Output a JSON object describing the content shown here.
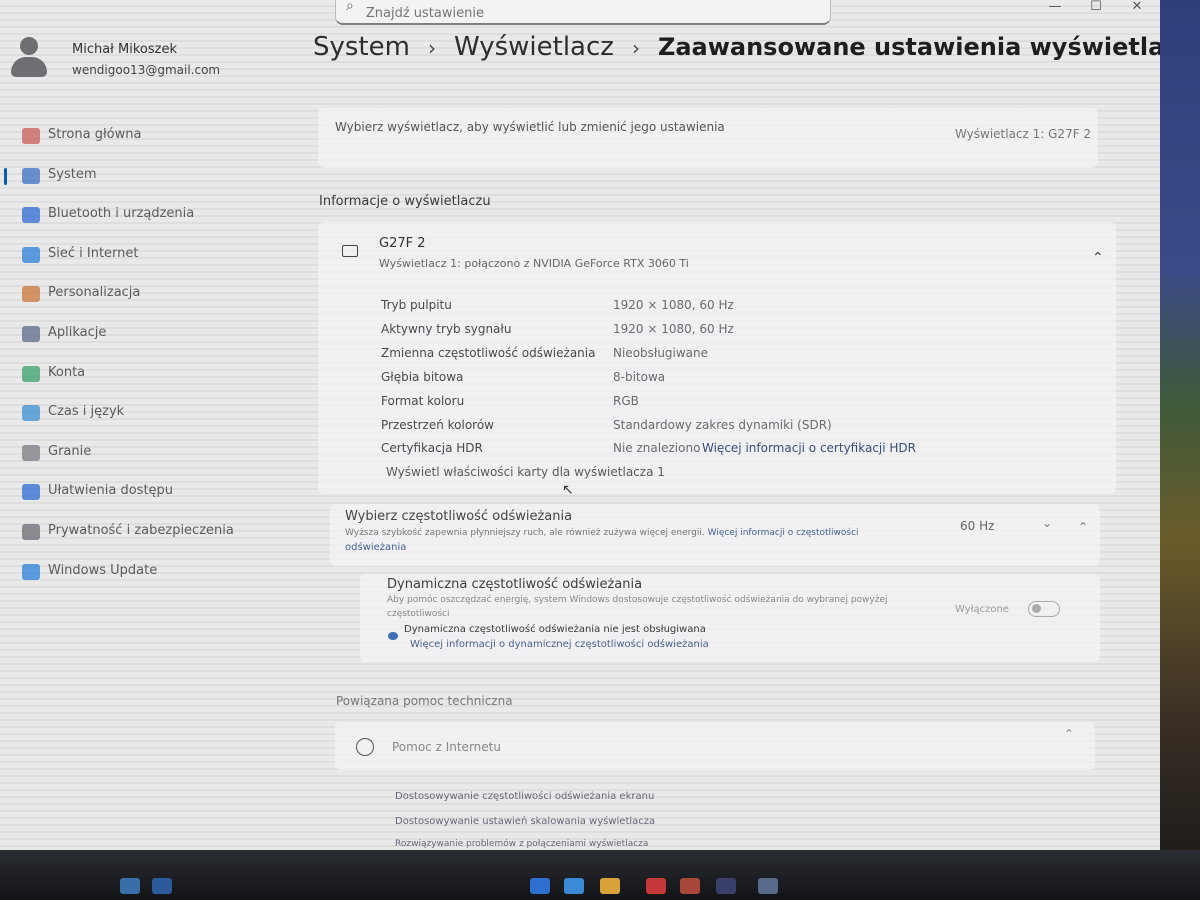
{
  "window": {
    "minimize_glyph": "—",
    "maximize_glyph": "☐",
    "close_glyph": "✕"
  },
  "search": {
    "placeholder": "Znajdź ustawienie"
  },
  "user": {
    "name": "Michał Mikoszek",
    "email": "wendigoo13@gmail.com"
  },
  "breadcrumb": {
    "items": [
      "System",
      "Wyświetlacz",
      "Zaawansowane ustawienia wyświetlacza"
    ],
    "separator": "›"
  },
  "sidebar": {
    "items": [
      {
        "label": "Strona główna",
        "icon": "home-icon",
        "color": "#c75a5a"
      },
      {
        "label": "System",
        "icon": "system-icon",
        "color": "#3b6fc4",
        "active": true
      },
      {
        "label": "Bluetooth i urządzenia",
        "icon": "bluetooth-icon",
        "color": "#2f6bd1"
      },
      {
        "label": "Sieć i Internet",
        "icon": "wifi-icon",
        "color": "#2b7fd6"
      },
      {
        "label": "Personalizacja",
        "icon": "brush-icon",
        "color": "#c9773a"
      },
      {
        "label": "Aplikacje",
        "icon": "apps-icon",
        "color": "#5b6a8a"
      },
      {
        "label": "Konta",
        "icon": "account-icon",
        "color": "#3aa06b"
      },
      {
        "label": "Czas i język",
        "icon": "globe-clock-icon",
        "color": "#3b8fd0"
      },
      {
        "label": "Granie",
        "icon": "gamepad-icon",
        "color": "#7a7a80"
      },
      {
        "label": "Ułatwienia dostępu",
        "icon": "accessibility-icon",
        "color": "#2f6bd1"
      },
      {
        "label": "Prywatność i zabezpieczenia",
        "icon": "shield-icon",
        "color": "#6a6a70"
      },
      {
        "label": "Windows Update",
        "icon": "update-icon",
        "color": "#2b7fd6"
      }
    ]
  },
  "main": {
    "select_display_label": "Wybierz wyświetlacz, aby wyświetlić lub zmienić jego ustawienia",
    "select_display_value": "Wyświetlacz 1: G27F 2",
    "display_info_heading": "Informacje o wyświetlaczu",
    "display": {
      "name": "G27F 2",
      "subtitle": "Wyświetlacz 1: połączono z NVIDIA GeForce RTX 3060 Ti",
      "collapse_glyph": "⌃",
      "rows": [
        {
          "label": "Tryb pulpitu",
          "value": "1920 × 1080, 60 Hz"
        },
        {
          "label": "Aktywny tryb sygnału",
          "value": "1920 × 1080, 60 Hz"
        },
        {
          "label": "Zmienna częstotliwość odświeżania",
          "value": "Nieobsługiwane"
        },
        {
          "label": "Głębia bitowa",
          "value": "8-bitowa"
        },
        {
          "label": "Format koloru",
          "value": "RGB"
        },
        {
          "label": "Przestrzeń kolorów",
          "value": "Standardowy zakres dynamiki (SDR)"
        },
        {
          "label": "Certyfikacja HDR",
          "value": "Nie znaleziono",
          "link": "Więcej informacji o certyfikacji HDR"
        }
      ],
      "adapter_link": "Wyświetl właściwości karty dla wyświetlacza 1"
    },
    "refresh": {
      "title": "Wybierz częstotliwość odświeżania",
      "desc_line1": "Wyższa szybkość zapewnia płynniejszy ruch, ale również zużywa więcej energii.",
      "desc_link": "Więcej informacji o częstotliwości",
      "desc_line2": "odświeżania",
      "value": "60 Hz",
      "dropdown_glyph": "⌄",
      "collapse_glyph": "⌃"
    },
    "dynamic": {
      "title": "Dynamiczna częstotliwość odświeżania",
      "desc_line1": "Aby pomóc oszczędzać energię, system Windows dostosowuje częstotliwość odświeżania do wybranej powyżej",
      "desc_line2": "częstotliwości",
      "toggle_label": "Wyłączone",
      "notice": "Dynamiczna częstotliwość odświeżania nie jest obsługiwana",
      "notice_link": "Więcej informacji o dynamicznej częstotliwości odświeżania"
    },
    "help": {
      "heading": "Powiązana pomoc techniczna",
      "item": "Pomoc z Internetu",
      "expand_glyph": "⌃",
      "links": [
        "Dostosowywanie częstotliwości odświeżania ekranu",
        "Dostosowywanie ustawień skalowania wyświetlacza",
        "Rozwiązywanie problemów z połączeniami wyświetlacza"
      ]
    }
  }
}
